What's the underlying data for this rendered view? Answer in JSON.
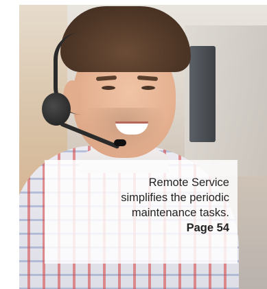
{
  "caption": {
    "text": "Remote Service\nsimplifies the periodic\nmaintenance tasks.",
    "page_ref": "Page 54"
  },
  "photo": {
    "subject_icon": "person-with-headset-photo"
  },
  "colors": {
    "caption_bg": "#ffffff",
    "caption_text": "#222222"
  }
}
